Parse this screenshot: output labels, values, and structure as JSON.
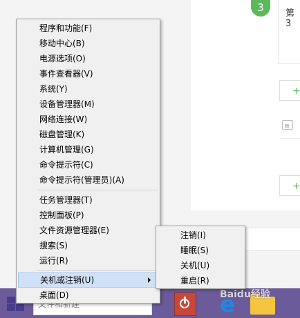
{
  "background": {
    "step_number": "3",
    "step_text": "第3",
    "add_buttons": [
      "+",
      "+"
    ]
  },
  "context_menu": {
    "items": [
      {
        "label": "程序和功能(F)"
      },
      {
        "label": "移动中心(B)"
      },
      {
        "label": "电源选项(O)"
      },
      {
        "label": "事件查看器(V)"
      },
      {
        "label": "系统(Y)"
      },
      {
        "label": "设备管理器(M)"
      },
      {
        "label": "网络连接(W)"
      },
      {
        "label": "磁盘管理(K)"
      },
      {
        "label": "计算机管理(G)"
      },
      {
        "label": "命令提示符(C)"
      },
      {
        "label": "命令提示符(管理员)(A)"
      },
      {
        "label": "任务管理器(T)"
      },
      {
        "label": "控制面板(P)"
      },
      {
        "label": "文件资源管理器(E)"
      },
      {
        "label": "搜索(S)"
      },
      {
        "label": "运行(R)"
      },
      {
        "label": "关机或注销(U)"
      },
      {
        "label": "桌面(D)"
      }
    ],
    "selected_index": 16
  },
  "shutdown_submenu": {
    "items": [
      {
        "label": "注销(I)"
      },
      {
        "label": "睡眠(S)"
      },
      {
        "label": "关机(U)"
      },
      {
        "label": "重启(R)"
      }
    ]
  },
  "taskbar": {
    "search_hint": "文件和新建",
    "watermark": "Baidu经验"
  },
  "colors": {
    "menu_bg": "#f0f0f0",
    "selected_bg": "#cfe0f7",
    "taskbar": "#6b5b9a",
    "step_green": "#5cb85c",
    "shutdown_red": "#c8463a"
  },
  "icons": [
    "windows-logo-icon",
    "search-icon",
    "power-icon",
    "internet-explorer-icon",
    "folder-icon",
    "image-icon",
    "submenu-arrow-icon"
  ]
}
